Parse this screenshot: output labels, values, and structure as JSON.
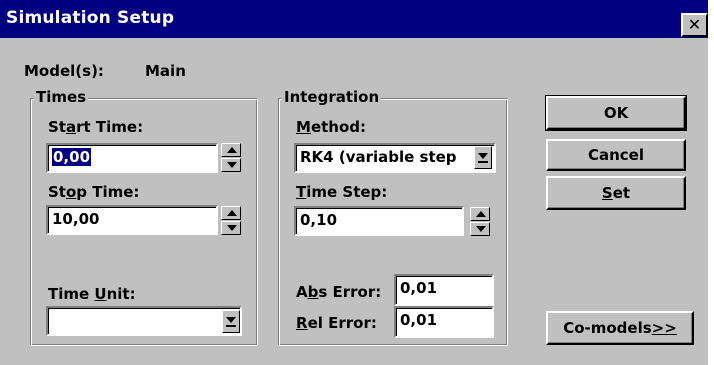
{
  "window": {
    "title": "Simulation Setup",
    "close_glyph": "✕"
  },
  "models": {
    "label": "Model(s):",
    "value": "Main"
  },
  "times": {
    "group_label": "Times",
    "start_label_pre": "St",
    "start_label_u": "a",
    "start_label_post": "rt Time:",
    "start_value": "0,00",
    "stop_label_pre": "St",
    "stop_label_u": "o",
    "stop_label_post": "p Time:",
    "stop_value": "10,00",
    "unit_label_pre": "Time ",
    "unit_label_u": "U",
    "unit_label_post": "nit:",
    "unit_value": ""
  },
  "integration": {
    "group_label": "Integration",
    "method_label_u": "M",
    "method_label_post": "ethod:",
    "method_value": "RK4 (variable step",
    "timestep_label_u": "T",
    "timestep_label_post": "ime Step:",
    "timestep_value": "0,10",
    "abs_label_pre": "A",
    "abs_label_u": "b",
    "abs_label_post": "s Error:",
    "abs_value": "0,01",
    "rel_label_u": "R",
    "rel_label_post": "el Error:",
    "rel_value": "0,01"
  },
  "buttons": {
    "ok": "OK",
    "cancel": "Cancel",
    "set_u": "S",
    "set_post": "et",
    "comodels_pre": "Co-models ",
    "comodels_u": ">>"
  },
  "colors": {
    "titlebar": "#000080",
    "face": "#c0c0c0",
    "selection": "#000080"
  }
}
